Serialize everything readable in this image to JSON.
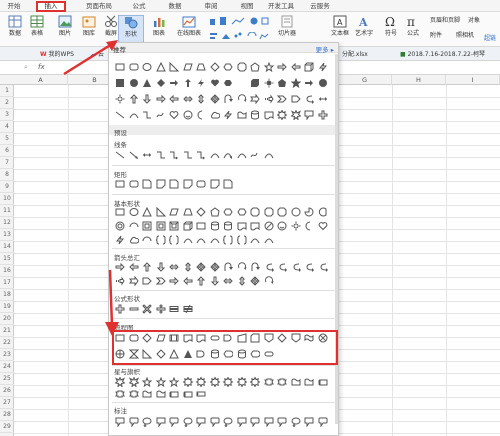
{
  "menu": {
    "tabs": [
      "开始",
      "插入",
      "页面布局",
      "公式",
      "数据",
      "审阅",
      "视图",
      "开发工具",
      "云服务"
    ],
    "active_index": 1
  },
  "ribbon": {
    "buttons": [
      "数据",
      "表格",
      "图片",
      "图库",
      "截屏",
      "形状",
      "图表",
      "在线图表"
    ],
    "right_items": [
      "切片器",
      "文本框",
      "艺术字",
      "符号",
      "公式"
    ],
    "right_small": [
      "页眉和页脚",
      "对象",
      "附件",
      "照相机"
    ],
    "far_right": "超链"
  },
  "tabrow": {
    "tab1": "我的WPS",
    "tab2": "云",
    "file_tab": "分配.xlsx",
    "date_tab": "2018.7.16-2018.7.22-柯琴"
  },
  "formula": {
    "fx": "fx"
  },
  "sheet": {
    "columns": [
      "A",
      "B",
      "C",
      "D",
      "E",
      "F",
      "G",
      "H",
      "I"
    ],
    "rows": [
      "1",
      "2",
      "3",
      "4",
      "5",
      "6",
      "7",
      "8",
      "9",
      "10",
      "11",
      "12",
      "13",
      "14",
      "15",
      "16",
      "17",
      "18",
      "19",
      "20",
      "21",
      "22",
      "23",
      "24",
      "25",
      "26",
      "27",
      "28",
      "29"
    ]
  },
  "panel": {
    "header": "推荐",
    "more": "更多",
    "sections": {
      "preset": "预设",
      "lines": "线条",
      "rect": "矩形",
      "basic": "基本形状",
      "arrows": "箭头总汇",
      "equation": "公式形状",
      "flowchart": "流程图",
      "stars": "星与旗帜",
      "callouts": "标注"
    }
  },
  "colors": {
    "accent": "#e03131",
    "link": "#2f6fd6",
    "shape_stroke": "#555555"
  }
}
